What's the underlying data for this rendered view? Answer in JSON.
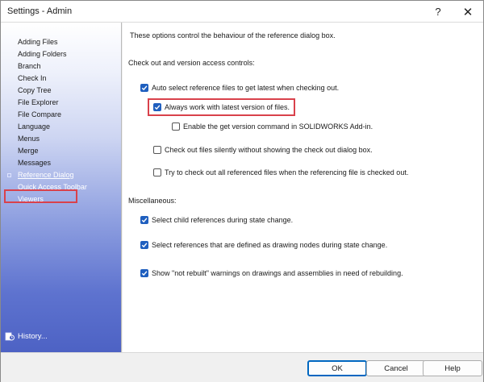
{
  "window": {
    "title": "Settings - Admin",
    "help_glyph": "?",
    "close_glyph": "✕"
  },
  "sidebar": {
    "items": [
      "Adding Files",
      "Adding Folders",
      "Branch",
      "Check In",
      "Copy Tree",
      "File Explorer",
      "File Compare",
      "Language",
      "Menus",
      "Merge",
      "Messages",
      "Reference Dialog",
      "Quick Access Toolbar",
      "Viewers"
    ],
    "selected": "Reference Dialog",
    "history_label": "History..."
  },
  "content": {
    "intro": "These options control the behaviour of the reference dialog box.",
    "section1_heading": "Check out and version access controls:",
    "options": [
      {
        "label": "Auto select reference files to get latest when checking out.",
        "checked": true
      },
      {
        "label": "Always work with latest version of files.",
        "checked": true
      },
      {
        "label": "Enable the get version command in SOLIDWORKS Add-in.",
        "checked": false
      },
      {
        "label": "Check out files silently without showing the check out dialog box.",
        "checked": false
      },
      {
        "label": "Try to check out all referenced files when the referencing file is checked out.",
        "checked": false
      }
    ],
    "section2_heading": "Miscellaneous:",
    "misc_options": [
      {
        "label": "Select child references during state change.",
        "checked": true
      },
      {
        "label": "Select references that are defined as drawing nodes during state change.",
        "checked": true
      },
      {
        "label": "Show \"not rebuilt\" warnings on drawings and assemblies in need of rebuilding.",
        "checked": true
      }
    ]
  },
  "footer": {
    "ok": "OK",
    "cancel": "Cancel",
    "help": "Help"
  },
  "colors": {
    "accent": "#1f5fbf",
    "highlight": "#d9414b",
    "sidebar_dark": "#4d62c4"
  }
}
